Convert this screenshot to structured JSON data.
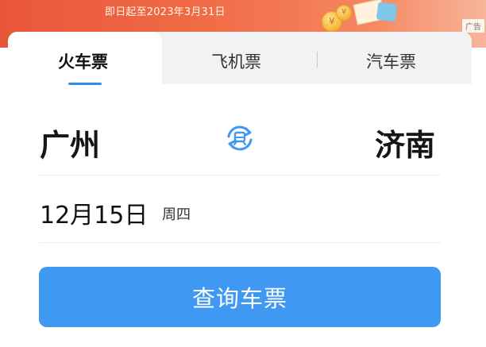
{
  "banner": {
    "text": "即日起至2023年3月31日",
    "ad_label": "广告"
  },
  "tabs": [
    {
      "label": "火车票",
      "active": true
    },
    {
      "label": "飞机票",
      "active": false
    },
    {
      "label": "汽车票",
      "active": false
    }
  ],
  "route": {
    "from": "广州",
    "to": "济南"
  },
  "date": {
    "value": "12月15日",
    "weekday": "周四"
  },
  "search_button": {
    "label": "查询车票"
  },
  "colors": {
    "accent": "#3f98f2",
    "banner": "#e8563a"
  },
  "icons": {
    "swap": "swap-cities-icon"
  }
}
